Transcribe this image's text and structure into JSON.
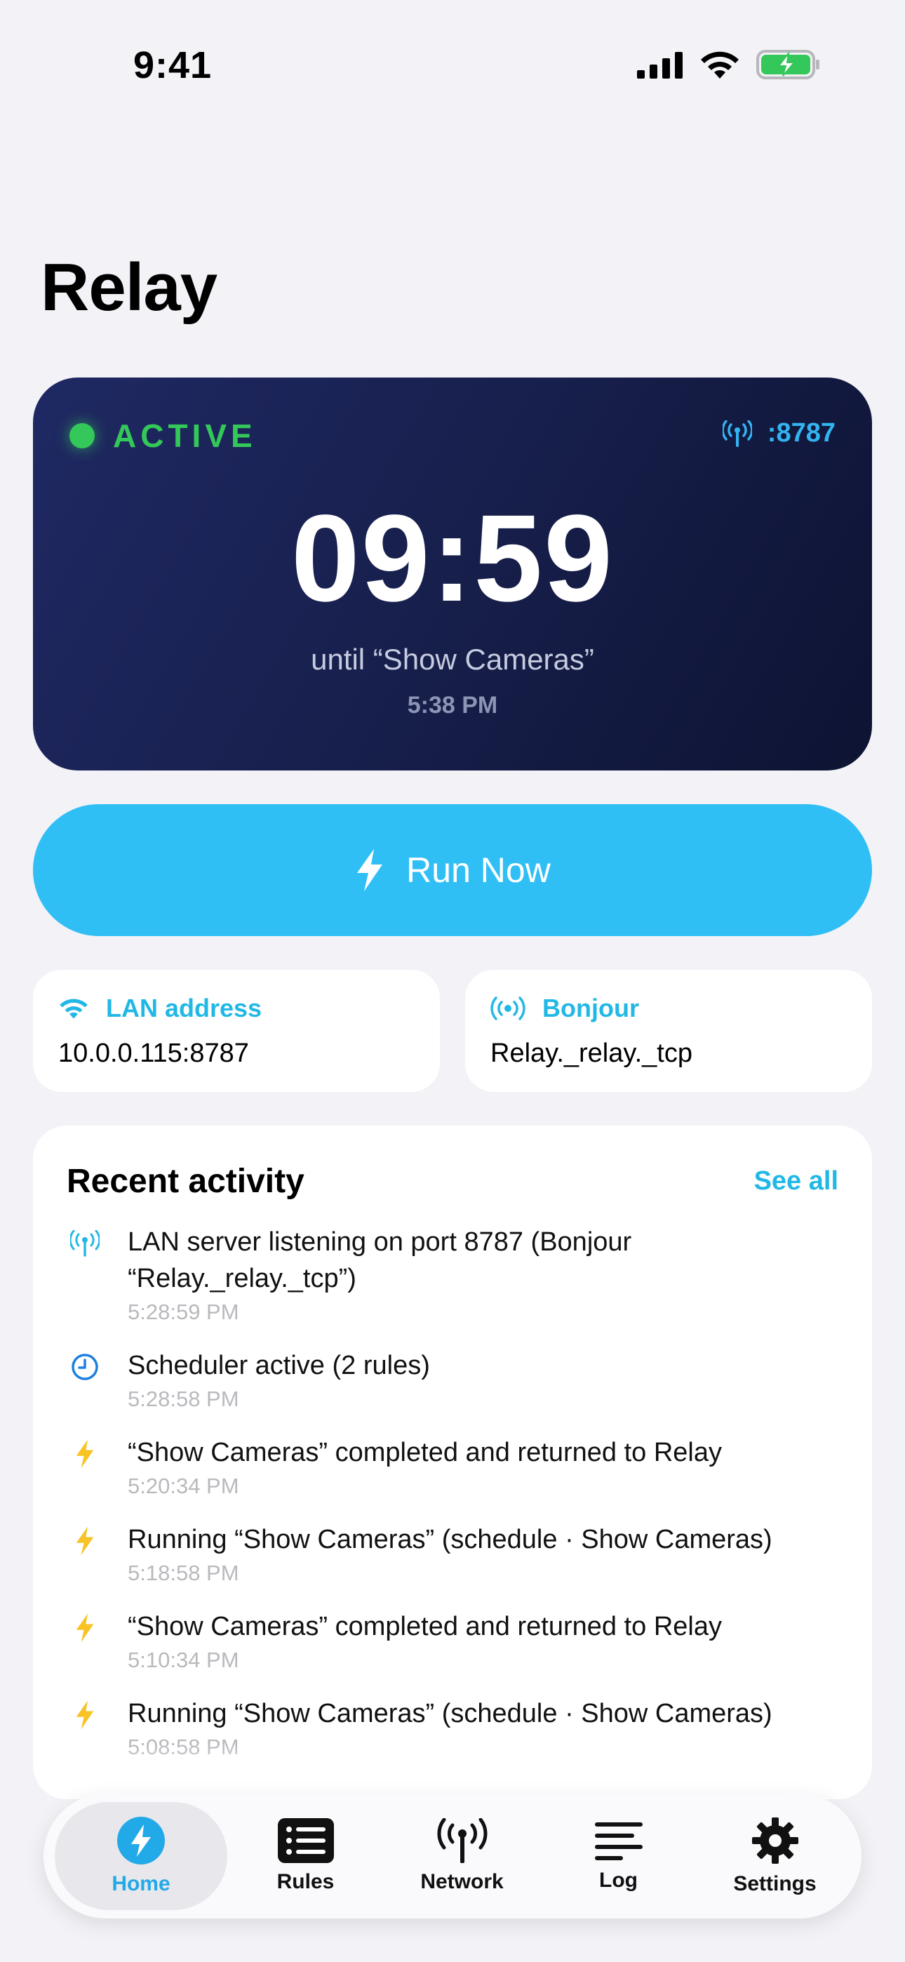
{
  "status_bar": {
    "time": "9:41"
  },
  "page": {
    "title": "Relay"
  },
  "hero": {
    "status": "ACTIVE",
    "port": ":8787",
    "countdown": "09:59",
    "until": "until “Show Cameras”",
    "time": "5:38 PM"
  },
  "run_button": {
    "label": "Run Now"
  },
  "info_cards": [
    {
      "label": "LAN address",
      "value": "10.0.0.115:8787",
      "icon": "wifi-icon"
    },
    {
      "label": "Bonjour",
      "value": "Relay._relay._tcp",
      "icon": "broadcast-icon"
    }
  ],
  "activity": {
    "title": "Recent activity",
    "see_all": "See all",
    "items": [
      {
        "icon": "antenna-icon",
        "text": "LAN server listening on port 8787 (Bonjour “Relay._relay._tcp”)",
        "time": "5:28:59 PM"
      },
      {
        "icon": "clock-icon",
        "text": "Scheduler active (2 rules)",
        "time": "5:28:58 PM"
      },
      {
        "icon": "bolt-icon",
        "text": "“Show Cameras” completed and returned to Relay",
        "time": "5:20:34 PM"
      },
      {
        "icon": "bolt-icon",
        "text": "Running “Show Cameras” (schedule · Show Cameras)",
        "time": "5:18:58 PM"
      },
      {
        "icon": "bolt-icon",
        "text": "“Show Cameras” completed and returned to Relay",
        "time": "5:10:34 PM"
      },
      {
        "icon": "bolt-icon",
        "text": "Running “Show Cameras” (schedule · Show Cameras)",
        "time": "5:08:58 PM"
      }
    ]
  },
  "tabs": [
    {
      "label": "Home",
      "icon": "bolt-circle-icon",
      "active": true
    },
    {
      "label": "Rules",
      "icon": "list-icon",
      "active": false
    },
    {
      "label": "Network",
      "icon": "antenna-icon",
      "active": false
    },
    {
      "label": "Log",
      "icon": "lines-icon",
      "active": false
    },
    {
      "label": "Settings",
      "icon": "gear-icon",
      "active": false
    }
  ],
  "colors": {
    "accent": "#30bff5",
    "active_green": "#34c759",
    "bolt_yellow": "#f7c325",
    "card_navy": "#1b2355"
  }
}
